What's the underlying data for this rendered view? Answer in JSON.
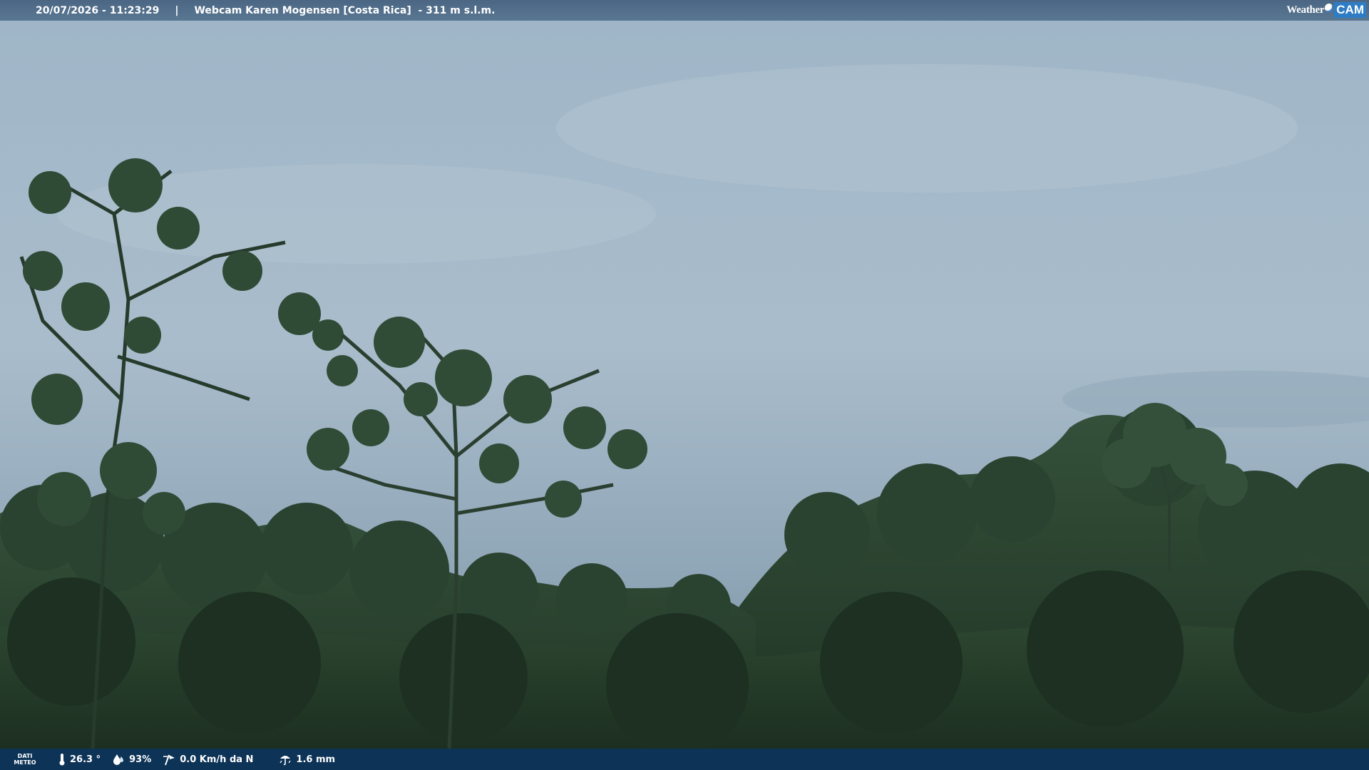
{
  "header": {
    "datetime": "20/07/2026 - 11:23:29",
    "separator": "|",
    "title": "Webcam Karen Mogensen [Costa Rica]  - 311 m s.l.m.",
    "logo": {
      "part1": "Weather",
      "part2": "CAM"
    }
  },
  "footer": {
    "label_line1": "DATI",
    "label_line2": "METEO",
    "temperature": "26.3 °",
    "humidity": "93%",
    "wind": "0.0 Km/h da N",
    "rain": "1.6 mm"
  },
  "icons": {
    "temperature": "thermometer-icon",
    "humidity": "humidity-drop-icon",
    "wind": "wind-icon",
    "rain": "rain-icon"
  },
  "colors": {
    "sky": "#a9bccb",
    "forest": "#23392a",
    "bar_top": "#4f6f8e",
    "bar_bottom": "#0c345c",
    "logo_accent": "#2d7cc4"
  }
}
